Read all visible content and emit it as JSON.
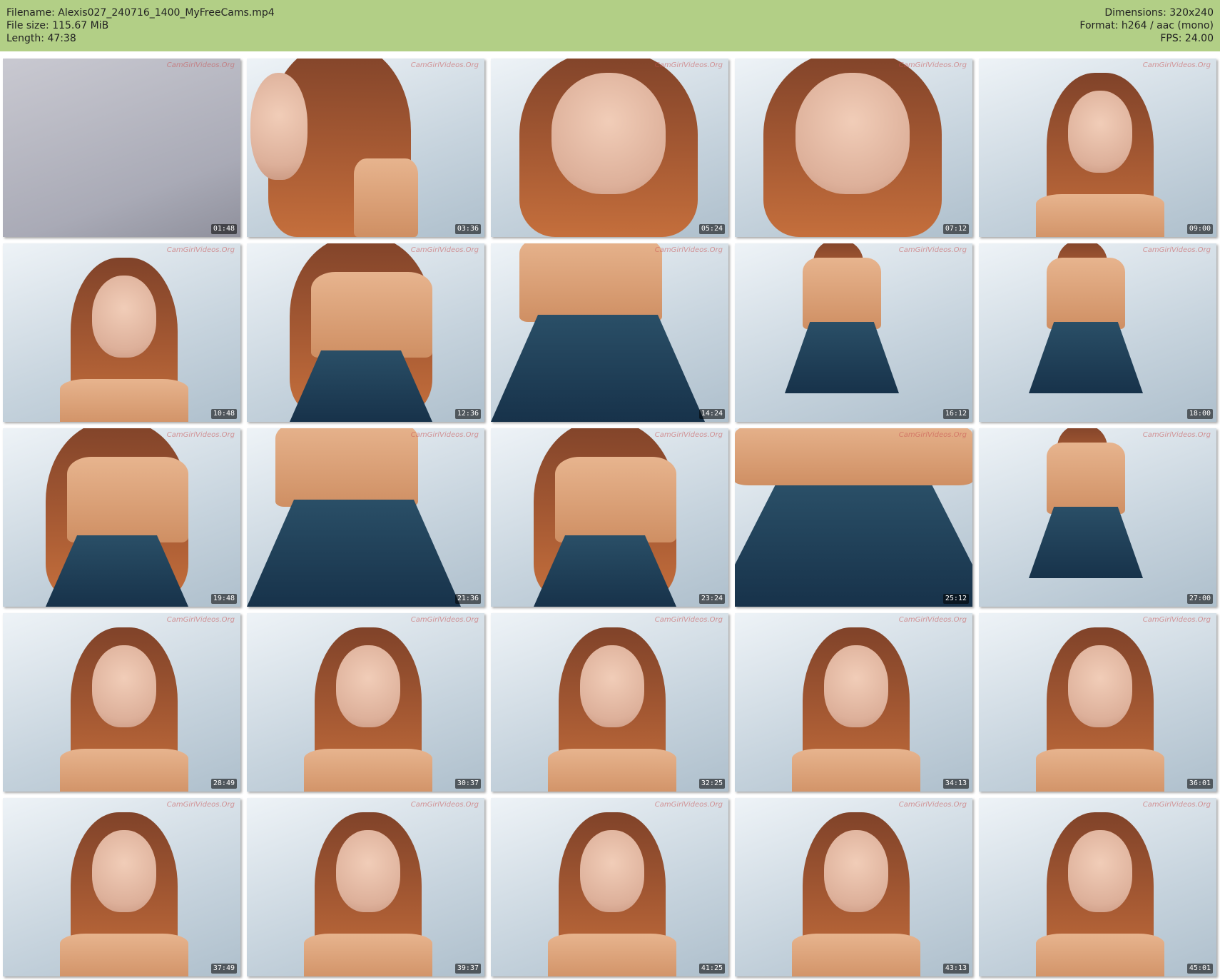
{
  "meta": {
    "filename": "Filename: Alexis027_240716_1400_MyFreeCams.mp4",
    "file_size": "File size: 115.67 MiB",
    "length": "Length: 47:38",
    "dimensions": "Dimensions: 320x240",
    "format": "Format: h264 / aac (mono)",
    "fps": "FPS: 24.00"
  },
  "watermark": "CamGirlVideos.Org",
  "thumbnails": [
    {
      "timestamp": "01:48",
      "scene": "blank"
    },
    {
      "timestamp": "03:36",
      "scene": "profile"
    },
    {
      "timestamp": "05:24",
      "scene": "closeup"
    },
    {
      "timestamp": "07:12",
      "scene": "closeup"
    },
    {
      "timestamp": "09:00",
      "scene": "portrait"
    },
    {
      "timestamp": "10:48",
      "scene": "portrait"
    },
    {
      "timestamp": "12:36",
      "scene": "bending"
    },
    {
      "timestamp": "14:24",
      "scene": "torso"
    },
    {
      "timestamp": "16:12",
      "scene": "standing"
    },
    {
      "timestamp": "18:00",
      "scene": "standing-back"
    },
    {
      "timestamp": "19:48",
      "scene": "bending"
    },
    {
      "timestamp": "21:36",
      "scene": "torso"
    },
    {
      "timestamp": "23:24",
      "scene": "bending"
    },
    {
      "timestamp": "25:12",
      "scene": "skirt"
    },
    {
      "timestamp": "27:00",
      "scene": "standing-back"
    },
    {
      "timestamp": "28:49",
      "scene": "portrait"
    },
    {
      "timestamp": "30:37",
      "scene": "portrait"
    },
    {
      "timestamp": "32:25",
      "scene": "portrait"
    },
    {
      "timestamp": "34:13",
      "scene": "portrait"
    },
    {
      "timestamp": "36:01",
      "scene": "portrait"
    },
    {
      "timestamp": "37:49",
      "scene": "portrait"
    },
    {
      "timestamp": "39:37",
      "scene": "portrait"
    },
    {
      "timestamp": "41:25",
      "scene": "portrait"
    },
    {
      "timestamp": "43:13",
      "scene": "portrait"
    },
    {
      "timestamp": "45:01",
      "scene": "portrait"
    }
  ]
}
